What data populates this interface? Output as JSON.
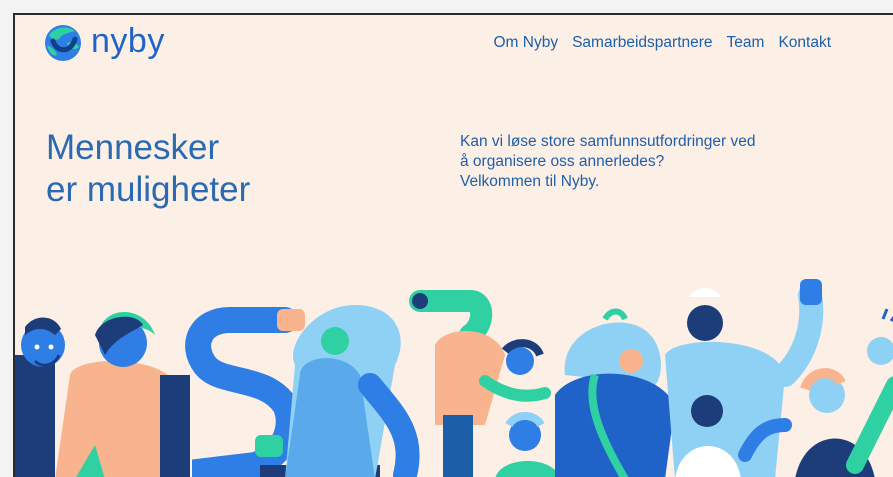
{
  "brand": {
    "name": "nyby"
  },
  "nav": {
    "items": [
      "Om Nyby",
      "Samarbeidspartnere",
      "Team",
      "Kontakt"
    ]
  },
  "hero": {
    "title_line1": "Mennesker",
    "title_line2": "er muligheter",
    "intro_line1": "Kan vi løse store samfunnsutfordringer ved",
    "intro_line2": "å organisere oss annerledes?",
    "intro_line3": "Velkommen til Nyby."
  },
  "colors": {
    "background": "#fcefe6",
    "brand_blue": "#1f63c9",
    "text_blue": "#1f5fa8",
    "peach": "#f7b48e",
    "teal": "#2fd1a3",
    "light_blue": "#8fd0f5",
    "dark_navy": "#1c3d7a"
  }
}
